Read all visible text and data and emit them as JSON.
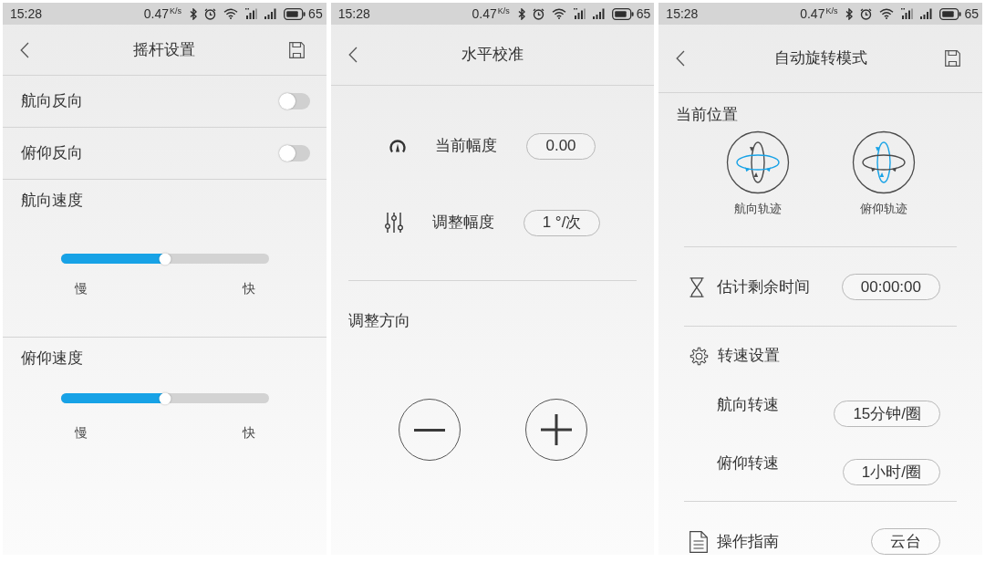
{
  "screens": [
    {
      "kind": "joystick",
      "status_bar": {
        "time": "15:28",
        "rate": "0.47",
        "rate_unit": "K/s",
        "battery": "65"
      },
      "header": {
        "title": "摇杆设置",
        "save": true
      },
      "items": [
        {
          "kind": "toggle",
          "label": "航向反向",
          "on": false
        },
        {
          "kind": "toggle",
          "label": "俯仰反向",
          "on": false
        },
        {
          "kind": "slider",
          "label": "航向速度",
          "level": 0.5,
          "min_label": "慢",
          "max_label": "快"
        },
        {
          "kind": "slider",
          "label": "俯仰速度",
          "level": 0.5,
          "min_label": "慢",
          "max_label": "快"
        }
      ]
    },
    {
      "kind": "level",
      "status_bar": {
        "time": "15:28",
        "rate": "0.47",
        "rate_unit": "K/s",
        "battery": "65"
      },
      "header": {
        "title": "水平校准",
        "save": false
      },
      "rows": [
        {
          "kind": "current",
          "label": "当前幅度",
          "value": "0.00"
        },
        {
          "kind": "step",
          "label": "调整幅度",
          "value": "1 °/次"
        }
      ],
      "direction": {
        "label": "调整方向"
      }
    },
    {
      "kind": "rotation",
      "status_bar": {
        "time": "15:28",
        "rate": "0.47",
        "rate_unit": "K/s",
        "battery": "65"
      },
      "header": {
        "title": "自动旋转模式",
        "save": true
      },
      "position": {
        "label": "当前位置",
        "axes": [
          {
            "kind": "yaw",
            "label": "航向轨迹"
          },
          {
            "kind": "pitch",
            "label": "俯仰轨迹"
          }
        ]
      },
      "remaining": {
        "label": "估计剩余时间",
        "value": "00:00:00"
      },
      "speed": {
        "label": "转速设置",
        "rows": [
          {
            "label": "航向转速",
            "value": "15分钟/圈"
          },
          {
            "label": "俯仰转速",
            "value": "1小时/圈"
          }
        ]
      },
      "guide": {
        "label": "操作指南",
        "value": "云台"
      }
    }
  ]
}
